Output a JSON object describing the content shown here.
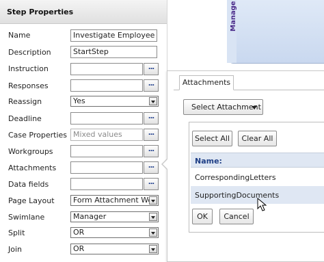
{
  "panel": {
    "title": "Step Properties",
    "rows": [
      {
        "label": "Name",
        "value": "Investigate Employee",
        "kind": "text"
      },
      {
        "label": "Description",
        "value": "StartStep",
        "kind": "text"
      },
      {
        "label": "Instruction",
        "value": "",
        "kind": "ellipsis"
      },
      {
        "label": "Responses",
        "value": "",
        "kind": "ellipsis"
      },
      {
        "label": "Reassign",
        "value": "Yes",
        "kind": "select"
      },
      {
        "label": "Deadline",
        "value": "",
        "kind": "ellipsis"
      },
      {
        "label": "Case Properties",
        "value": "Mixed values",
        "kind": "ellipsis-gray"
      },
      {
        "label": "Workgroups",
        "value": "",
        "kind": "ellipsis"
      },
      {
        "label": "Attachments",
        "value": "",
        "kind": "ellipsis"
      },
      {
        "label": "Data fields",
        "value": "",
        "kind": "ellipsis"
      },
      {
        "label": "Page Layout",
        "value": "Form Attachment Wo",
        "kind": "select"
      },
      {
        "label": "Swimlane",
        "value": "Manager",
        "kind": "select"
      },
      {
        "label": "Split",
        "value": "OR",
        "kind": "select"
      },
      {
        "label": "Join",
        "value": "OR",
        "kind": "select"
      }
    ],
    "ellipsis_label": "..."
  },
  "canvas": {
    "lane_label": "Manage"
  },
  "popup": {
    "tab_label": "Attachments",
    "select_attachment_label": "Select Attachment",
    "select_all_label": "Select All",
    "clear_all_label": "Clear All",
    "list_header": "Name:",
    "items": [
      "CorrespondingLetters",
      "SupportingDocuments"
    ],
    "ok_label": "OK",
    "cancel_label": "Cancel"
  }
}
